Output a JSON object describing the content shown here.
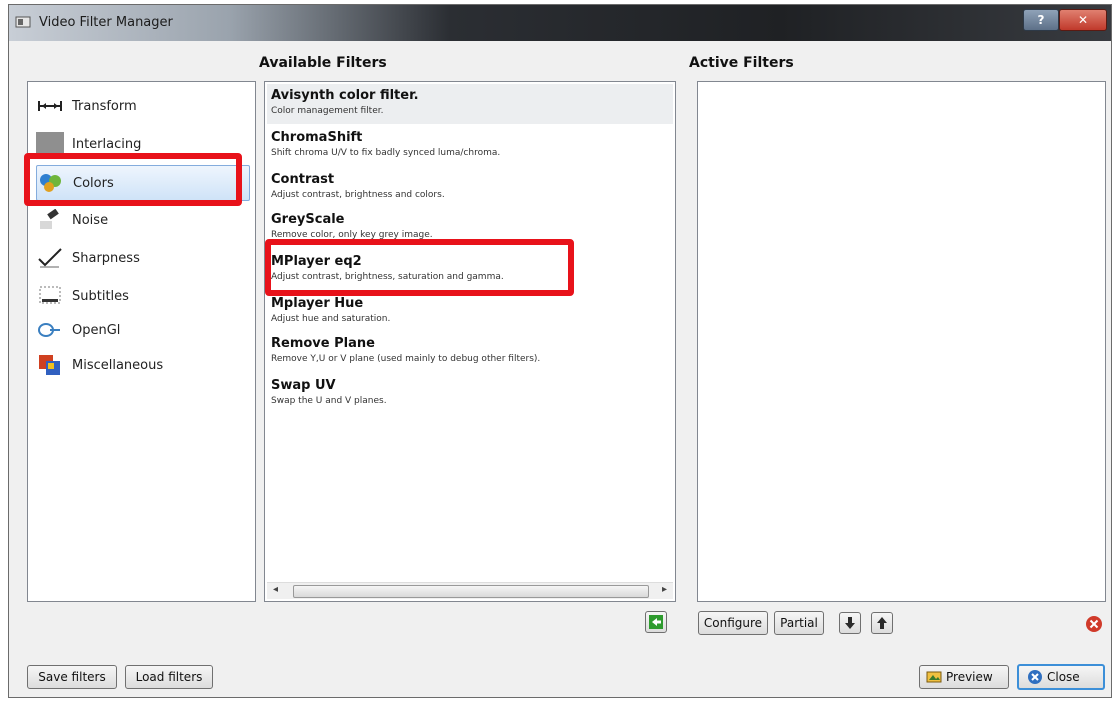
{
  "window": {
    "title": "Video Filter Manager",
    "help_glyph": "?",
    "close_glyph": "✕"
  },
  "headings": {
    "available": "Available Filters",
    "active": "Active Filters"
  },
  "categories": [
    {
      "label": "Transform",
      "icon": "transform-icon",
      "selected": false
    },
    {
      "label": "Interlacing",
      "icon": "interlacing-icon",
      "selected": false
    },
    {
      "label": "Colors",
      "icon": "colors-icon",
      "selected": true
    },
    {
      "label": "Noise",
      "icon": "noise-icon",
      "selected": false
    },
    {
      "label": "Sharpness",
      "icon": "sharpness-icon",
      "selected": false
    },
    {
      "label": "Subtitles",
      "icon": "subtitles-icon",
      "selected": false
    },
    {
      "label": "OpenGl",
      "icon": "opengl-icon",
      "selected": false
    },
    {
      "label": "Miscellaneous",
      "icon": "miscellaneous-icon",
      "selected": false
    }
  ],
  "filters": [
    {
      "name": "Avisynth color filter.",
      "desc": "Color management filter."
    },
    {
      "name": "ChromaShift",
      "desc": "Shift chroma U/V to fix badly synced luma/chroma."
    },
    {
      "name": "Contrast",
      "desc": "Adjust contrast, brightness and colors."
    },
    {
      "name": "GreyScale",
      "desc": "Remove color, only key grey image."
    },
    {
      "name": "MPlayer eq2",
      "desc": "Adjust contrast, brightness, saturation and gamma."
    },
    {
      "name": "Mplayer Hue",
      "desc": "Adjust hue and saturation."
    },
    {
      "name": "Remove Plane",
      "desc": "Remove Y,U or V plane (used mainly to debug other filters)."
    },
    {
      "name": "Swap UV",
      "desc": "Swap the U and V planes."
    }
  ],
  "buttons": {
    "configure": "Configure",
    "partial": "Partial",
    "save_filters": "Save filters",
    "load_filters": "Load filters",
    "preview": "Preview",
    "close": "Close"
  },
  "colors": {
    "highlight": "#e8121a",
    "add_green": "#2e9b2e"
  }
}
